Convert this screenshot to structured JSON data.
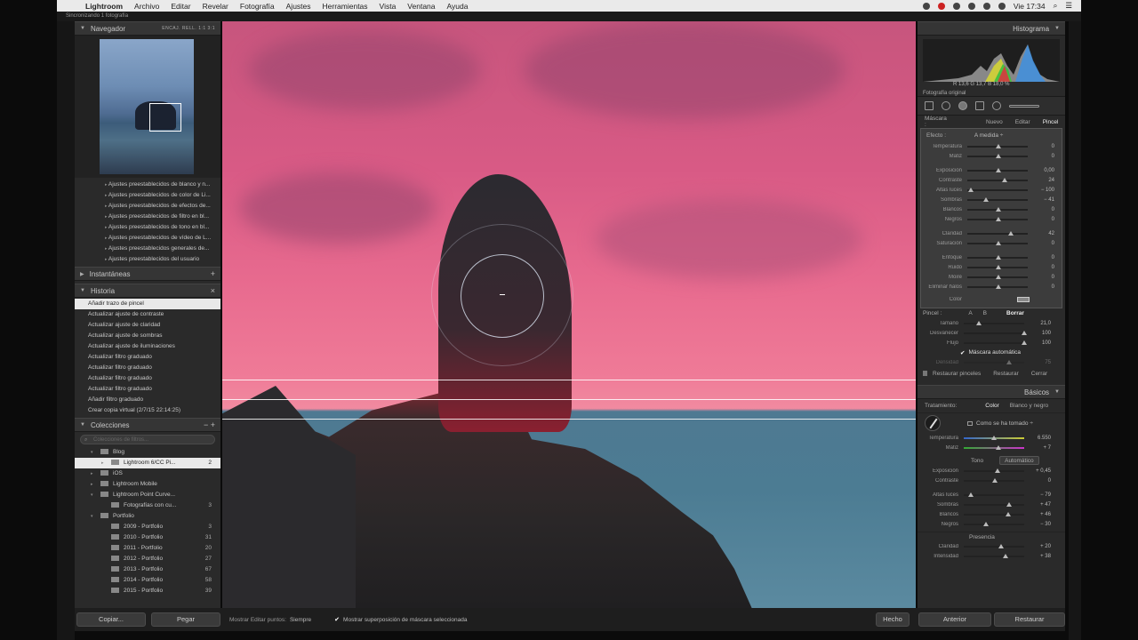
{
  "menubar": {
    "app": "Lightroom",
    "items": [
      "Archivo",
      "Editar",
      "Revelar",
      "Fotografía",
      "Ajustes",
      "Herramientas",
      "Vista",
      "Ventana",
      "Ayuda"
    ],
    "clock": "Vie 17:34"
  },
  "status": "Sincronizando 1 fotografía",
  "navigator": {
    "title": "Navegador",
    "options": "ENCAJ.   RELL.   1:1   3:1"
  },
  "presets": [
    "Ajustes preestablecidos de blanco y n...",
    "Ajustes preestablecidos de color de Li...",
    "Ajustes preestablecidos de efectos de...",
    "Ajustes preestablecidos de filtro en bl...",
    "Ajustes preestablecidos de tono en bl...",
    "Ajustes preestablecidos de vídeo de L...",
    "Ajustes preestablecidos generales de...",
    "Ajustes preestablecidos del usuario"
  ],
  "snapshots": {
    "title": "Instantáneas",
    "action": "+"
  },
  "history": {
    "title": "Historia",
    "action": "×",
    "items": [
      "Añadir trazo de pincel",
      "Actualizar ajuste de contraste",
      "Actualizar ajuste de claridad",
      "Actualizar ajuste de sombras",
      "Actualizar ajuste de iluminaciones",
      "Actualizar filtro graduado",
      "Actualizar filtro graduado",
      "Actualizar filtro graduado",
      "Actualizar filtro graduado",
      "Añadir filtro graduado",
      "Crear copia virtual (2/7/15 22:14:25)"
    ]
  },
  "collections": {
    "title": "Colecciones",
    "actions": "−  +",
    "search_placeholder": "Colecciones de filtros...",
    "items": [
      {
        "label": "Blog",
        "count": "",
        "indent": 1,
        "caret": "▾",
        "sel": false
      },
      {
        "label": "Lightroom 6/CC Pi...",
        "count": "2",
        "indent": 2,
        "caret": "▸",
        "sel": true
      },
      {
        "label": "iOS",
        "count": "",
        "indent": 1,
        "caret": "▸",
        "sel": false
      },
      {
        "label": "Lightroom Mobile",
        "count": "",
        "indent": 1,
        "caret": "▸",
        "sel": false
      },
      {
        "label": "Lightroom Point Curve...",
        "count": "",
        "indent": 1,
        "caret": "▾",
        "sel": false
      },
      {
        "label": "Fotografías con cu...",
        "count": "3",
        "indent": 2,
        "caret": "",
        "sel": false
      },
      {
        "label": "Portfolio",
        "count": "",
        "indent": 1,
        "caret": "▾",
        "sel": false
      },
      {
        "label": "2009 - Portfolio",
        "count": "3",
        "indent": 2,
        "caret": "",
        "sel": false
      },
      {
        "label": "2010 - Portfolio",
        "count": "31",
        "indent": 2,
        "caret": "",
        "sel": false
      },
      {
        "label": "2011 - Portfolio",
        "count": "20",
        "indent": 2,
        "caret": "",
        "sel": false
      },
      {
        "label": "2012 - Portfolio",
        "count": "27",
        "indent": 2,
        "caret": "",
        "sel": false
      },
      {
        "label": "2013 - Portfolio",
        "count": "67",
        "indent": 2,
        "caret": "",
        "sel": false
      },
      {
        "label": "2014 - Portfolio",
        "count": "58",
        "indent": 2,
        "caret": "",
        "sel": false
      },
      {
        "label": "2015 - Portfolio",
        "count": "39",
        "indent": 2,
        "caret": "",
        "sel": false
      }
    ]
  },
  "bottom": {
    "copy": "Copiar...",
    "paste": "Pegar",
    "show_points_label": "Mostrar Editar puntos:",
    "show_points_value": "Siempre",
    "overlay_label": "Mostrar superposición de máscara seleccionada",
    "done": "Hecho",
    "previous": "Anterior",
    "restore": "Restaurar"
  },
  "histogram": {
    "title": "Histograma",
    "r_label": "R",
    "r": "13,6",
    "g_label": "G",
    "g": "13,7",
    "b_label": "B",
    "b": "18,0 %",
    "original": "Fotografía original"
  },
  "mask": {
    "label": "Máscara :",
    "new": "Nuevo",
    "edit": "Editar",
    "brush": "Pincel"
  },
  "effect": {
    "label": "Efecto :",
    "value": "A medida ÷"
  },
  "sliders": [
    {
      "label": "Temperatura",
      "value": "0",
      "pos": 0.5,
      "group": 1
    },
    {
      "label": "Matiz",
      "value": "0",
      "pos": 0.5,
      "group": 1
    },
    {
      "label": "Exposición",
      "value": "0,00",
      "pos": 0.5,
      "group": 2
    },
    {
      "label": "Contraste",
      "value": "24",
      "pos": 0.6,
      "group": 2
    },
    {
      "label": "Altas luces",
      "value": "− 100",
      "pos": 0.05,
      "group": 2
    },
    {
      "label": "Sombras",
      "value": "− 41",
      "pos": 0.3,
      "group": 2
    },
    {
      "label": "Blancos",
      "value": "0",
      "pos": 0.5,
      "group": 2
    },
    {
      "label": "Negros",
      "value": "0",
      "pos": 0.5,
      "group": 2
    },
    {
      "label": "Claridad",
      "value": "42",
      "pos": 0.7,
      "group": 3
    },
    {
      "label": "Saturación",
      "value": "0",
      "pos": 0.5,
      "group": 3
    },
    {
      "label": "Enfoque",
      "value": "0",
      "pos": 0.5,
      "group": 4
    },
    {
      "label": "Ruido",
      "value": "0",
      "pos": 0.5,
      "group": 4
    },
    {
      "label": "Moiré",
      "value": "0",
      "pos": 0.5,
      "group": 4
    },
    {
      "label": "Eliminar halos",
      "value": "0",
      "pos": 0.5,
      "group": 4
    }
  ],
  "color_label": "Color",
  "brush": {
    "label": "Pincel :",
    "a": "A",
    "b": "B",
    "erase": "Borrar",
    "size_label": "Tamaño",
    "size": "21,0",
    "feather_label": "Desvanecer",
    "feather": "100",
    "flow_label": "Flujo",
    "flow": "100",
    "automask": "Máscara automática",
    "density_label": "Densidad",
    "density": "75",
    "restore_brushes": "Restaurar pinceles",
    "restore": "Restaurar",
    "close": "Cerrar"
  },
  "basic": {
    "title": "Básicos",
    "treatment_label": "Tratamiento:",
    "color": "Color",
    "bw": "Blanco y negro",
    "wb_value": "Como se ha tomado ÷",
    "temp_label": "Temperatura",
    "temp": "6.550",
    "tint_label": "Matiz",
    "tint": "+ 7",
    "tone_label": "Tono",
    "auto": "Automático",
    "tone": [
      {
        "label": "Exposición",
        "value": "+ 0,45",
        "pos": 0.55
      },
      {
        "label": "Contraste",
        "value": "0",
        "pos": 0.5
      }
    ],
    "tone2": [
      {
        "label": "Altas luces",
        "value": "− 79",
        "pos": 0.1
      },
      {
        "label": "Sombras",
        "value": "+ 47",
        "pos": 0.73
      },
      {
        "label": "Blancos",
        "value": "+ 46",
        "pos": 0.72
      },
      {
        "label": "Negros",
        "value": "− 30",
        "pos": 0.35
      }
    ],
    "presence_label": "Presencia",
    "presence": [
      {
        "label": "Claridad",
        "value": "+ 20",
        "pos": 0.6
      },
      {
        "label": "Intensidad",
        "value": "+ 38",
        "pos": 0.68
      }
    ]
  }
}
